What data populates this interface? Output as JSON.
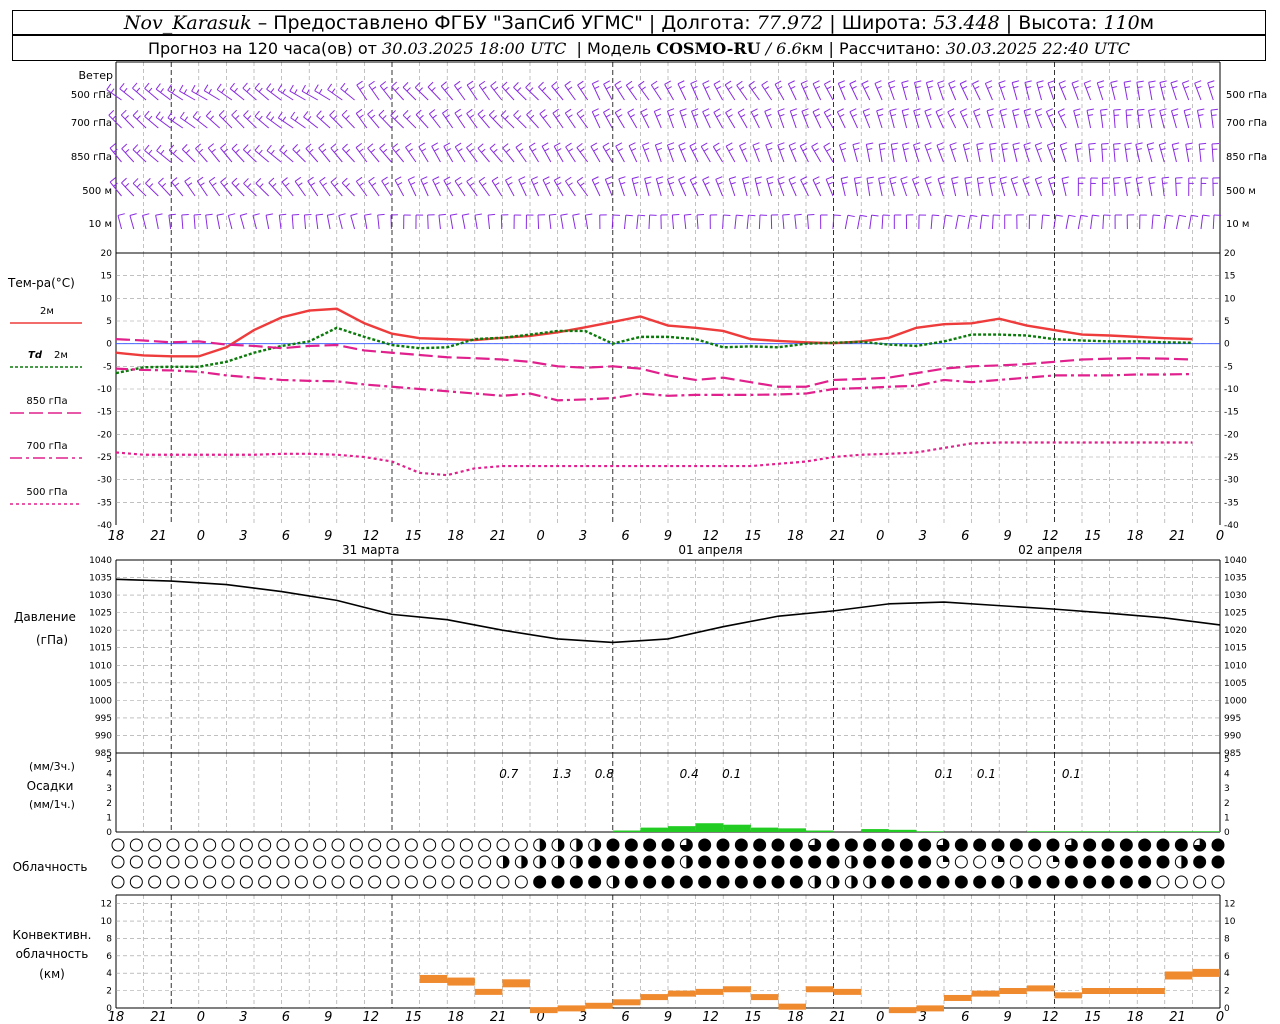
{
  "header": {
    "station": "Nov_Karasuk",
    "provider": "– Предоставлено ФГБУ \"ЗапСиб УГМС\"",
    "sep": "|",
    "lon_label": "Долгота:",
    "lon_value": "77.972",
    "lat_label": "Широта:",
    "lat_value": "53.448",
    "alt_label": "Высота:",
    "alt_value": "110",
    "alt_unit": "м"
  },
  "subheader": {
    "forecast_prefix": "Прогноз на 120 часа(ов) от",
    "forecast_start": "30.03.2025 18:00 UTC",
    "model_label": "Модель",
    "model_name": "COSMO-RU",
    "model_res_value": "/ 6.6",
    "model_res_unit": "км",
    "calc_label": "Рассчитано:",
    "calc_time": "30.03.2025 22:40 UTC"
  },
  "time_axis": {
    "hours": [
      "18",
      "21",
      "0",
      "3",
      "6",
      "9",
      "12",
      "15",
      "18",
      "21",
      "0",
      "3",
      "6",
      "9",
      "12",
      "15",
      "18",
      "21",
      "0",
      "3",
      "6",
      "9",
      "12",
      "15",
      "18",
      "21",
      "0"
    ],
    "day_labels": [
      {
        "at": 6,
        "text": "31 марта"
      },
      {
        "at": 14,
        "text": "01 апреля"
      },
      {
        "at": 22,
        "text": "02 апреля"
      }
    ]
  },
  "wind": {
    "title": "Ветер",
    "levels": [
      "500 гПа",
      "700 гПа",
      "850 гПа",
      "500 м",
      "10 м"
    ],
    "color": "#8a2be2"
  },
  "temperature": {
    "title": "Тем-ра(°C)",
    "y_ticks": [
      "20",
      "15",
      "10",
      "5",
      "0",
      "-5",
      "-10",
      "-15",
      "-20",
      "-25",
      "-30",
      "-35",
      "-40"
    ],
    "legend": [
      {
        "label": "2м",
        "color": "#ee3b3b",
        "dash": ""
      },
      {
        "label_main": "Td",
        "label": "2м",
        "color": "#0a7a0a",
        "dash": "3,2"
      },
      {
        "label": "850 гПа",
        "color": "#e0208c",
        "dash": "14,5"
      },
      {
        "label": "700 гПа",
        "color": "#e0208c",
        "dash": "12,4,3,4"
      },
      {
        "label": "500 гПа",
        "color": "#e0208c",
        "dash": "3,3"
      }
    ]
  },
  "pressure": {
    "title_1": "Давление",
    "title_2": "(гПа)",
    "y_ticks": [
      "1040",
      "1035",
      "1030",
      "1025",
      "1020",
      "1015",
      "1010",
      "1005",
      "1000",
      "995",
      "990",
      "985"
    ]
  },
  "precipitation": {
    "title_1": "(мм/3ч.)",
    "title_2": "Осадки",
    "title_3": "(мм/1ч.)",
    "y_ticks": [
      "5",
      "4",
      "3",
      "2",
      "1",
      "0"
    ],
    "amounts": [
      {
        "at": 9.25,
        "text": "0.7"
      },
      {
        "at": 10.5,
        "text": "1.3"
      },
      {
        "at": 11.5,
        "text": "0.8"
      },
      {
        "at": 13.5,
        "text": "0.4"
      },
      {
        "at": 14.5,
        "text": "0.1"
      },
      {
        "at": 19.5,
        "text": "0.1"
      },
      {
        "at": 20.5,
        "text": "0.1"
      },
      {
        "at": 22.5,
        "text": "0.1"
      }
    ]
  },
  "cloud": {
    "title": "Облачность"
  },
  "convective": {
    "title_1": "Конвективн.",
    "title_2": "облачность",
    "title_3": "(км)",
    "y_ticks": [
      "12",
      "10",
      "8",
      "6",
      "4",
      "2",
      "0"
    ]
  },
  "chart_data": [
    {
      "type": "line",
      "title": "Тем-ра(°C)",
      "x": [
        0,
        3,
        6,
        9,
        12,
        15,
        18,
        21,
        24,
        27,
        30,
        33,
        36,
        39,
        42,
        45,
        48,
        51,
        54,
        57,
        60,
        63,
        66,
        69,
        72,
        75,
        78,
        81,
        84,
        87,
        90,
        93,
        96,
        99,
        102,
        105,
        108,
        111,
        114,
        117,
        120
      ],
      "ylim": [
        -40,
        20
      ],
      "series": [
        {
          "name": "2м",
          "values": [
            -2,
            -2.6,
            -2.8,
            -2.8,
            -0.8,
            3,
            5.8,
            7.3,
            7.7,
            4.5,
            2.2,
            1.2,
            1,
            0.8,
            1.3,
            1.7,
            2.5,
            3.6,
            4.8,
            6,
            4,
            3.5,
            2.8,
            1,
            0.6,
            0.3,
            0.1,
            0.5,
            1.3,
            3.5,
            4.3,
            4.5,
            5.5,
            4,
            3,
            2,
            1.8,
            1.5,
            1.2,
            1
          ]
        },
        {
          "name": "Td 2м",
          "values": [
            -6.5,
            -5.2,
            -5.1,
            -5.1,
            -4,
            -2,
            -0.5,
            0.5,
            3.5,
            1.5,
            -0.3,
            -1,
            -0.8,
            1,
            1.3,
            2,
            2.8,
            2.8,
            0,
            1.5,
            1.5,
            1,
            -0.8,
            -0.6,
            -0.8,
            0,
            0.2,
            0.4,
            -0.2,
            -0.5,
            0.5,
            2,
            2,
            1.8,
            1,
            0.7,
            0.5,
            0.5,
            0.3,
            0.2
          ]
        },
        {
          "name": "850 гПа",
          "values": [
            1,
            0.7,
            0.3,
            0.5,
            -0.2,
            -0.5,
            -1,
            -0.5,
            -0.3,
            -1.5,
            -2,
            -2.5,
            -3,
            -3.2,
            -3.5,
            -4,
            -5,
            -5.3,
            -5,
            -5.5,
            -7,
            -8,
            -7.5,
            -8.5,
            -9.5,
            -9.5,
            -8,
            -7.8,
            -7.5,
            -6.5,
            -5.5,
            -5,
            -4.8,
            -4.5,
            -4,
            -3.5,
            -3.3,
            -3.2,
            -3.3,
            -3.5
          ]
        },
        {
          "name": "700 гПа",
          "values": [
            -5.5,
            -5.8,
            -5.9,
            -6.2,
            -7,
            -7.5,
            -8,
            -8.2,
            -8.3,
            -9,
            -9.5,
            -10,
            -10.5,
            -11,
            -11.5,
            -11,
            -12.5,
            -12.3,
            -12,
            -11,
            -11.5,
            -11.3,
            -11.3,
            -11.3,
            -11.2,
            -11,
            -10,
            -9.8,
            -9.5,
            -9.3,
            -8,
            -8.5,
            -8,
            -7.5,
            -7,
            -7,
            -7,
            -6.8,
            -6.8,
            -6.7
          ]
        },
        {
          "name": "500 гПа",
          "values": [
            -24,
            -24.5,
            -24.5,
            -24.5,
            -24.5,
            -24.5,
            -24.3,
            -24.3,
            -24.5,
            -25,
            -26,
            -28.5,
            -29,
            -27.5,
            -27,
            -27,
            -27,
            -27,
            -27,
            -27,
            -27,
            -27,
            -27,
            -27,
            -26.5,
            -26,
            -25,
            -24.5,
            -24.3,
            -24,
            -23,
            -22,
            -21.8,
            -21.8,
            -21.8,
            -21.8,
            -21.8,
            -21.8,
            -21.8,
            -21.8
          ]
        }
      ]
    },
    {
      "type": "line",
      "title": "Давление",
      "ylabel": "(гПа)",
      "ylim": [
        985,
        1040
      ],
      "x": [
        0,
        6,
        12,
        18,
        24,
        30,
        36,
        42,
        48,
        54,
        60,
        66,
        72,
        78,
        84,
        90,
        96,
        102,
        108,
        114,
        120
      ],
      "series": [
        {
          "name": "Давление",
          "values": [
            1034.5,
            1034,
            1033,
            1031,
            1028.5,
            1024.5,
            1023,
            1020,
            1017.5,
            1016.5,
            1017.5,
            1021,
            1024,
            1025.5,
            1027.5,
            1028,
            1027,
            1026,
            1024.8,
            1023.5,
            1021.5
          ]
        }
      ]
    },
    {
      "type": "bar",
      "title": "Осадки",
      "ylim": [
        0,
        5
      ],
      "x": [
        57,
        60,
        63,
        66,
        69,
        72,
        75,
        78,
        81,
        84,
        87,
        90,
        93,
        96,
        99,
        102,
        105,
        108,
        111,
        114,
        117,
        120
      ],
      "values": [
        0.1,
        0.3,
        0.4,
        0.6,
        0.5,
        0.3,
        0.25,
        0.1,
        0,
        0.2,
        0.15,
        0.05,
        0,
        0,
        0,
        0.05,
        0.05,
        0.05,
        0.05,
        0.05,
        0.05,
        0.05
      ]
    },
    {
      "type": "bar",
      "title": "Конвективн. облачность",
      "ylabel": "(км)",
      "ylim": [
        0,
        13
      ],
      "x": [
        36,
        39,
        42,
        45,
        48,
        51,
        54,
        57,
        60,
        63,
        66,
        69,
        72,
        75,
        78,
        81,
        84,
        87,
        90,
        93,
        96,
        99,
        102,
        105,
        108,
        111,
        114,
        117,
        120
      ],
      "values": [
        3.8,
        3.5,
        2.2,
        3.3,
        0.1,
        0.3,
        0.6,
        1,
        1.6,
        2,
        2.2,
        2.5,
        1.6,
        0.5,
        2.5,
        2.2,
        0,
        0.1,
        0.3,
        1.5,
        2,
        2.3,
        2.6,
        1.8,
        2.3,
        2.3,
        2.3,
        4.2,
        4.5
      ]
    }
  ]
}
